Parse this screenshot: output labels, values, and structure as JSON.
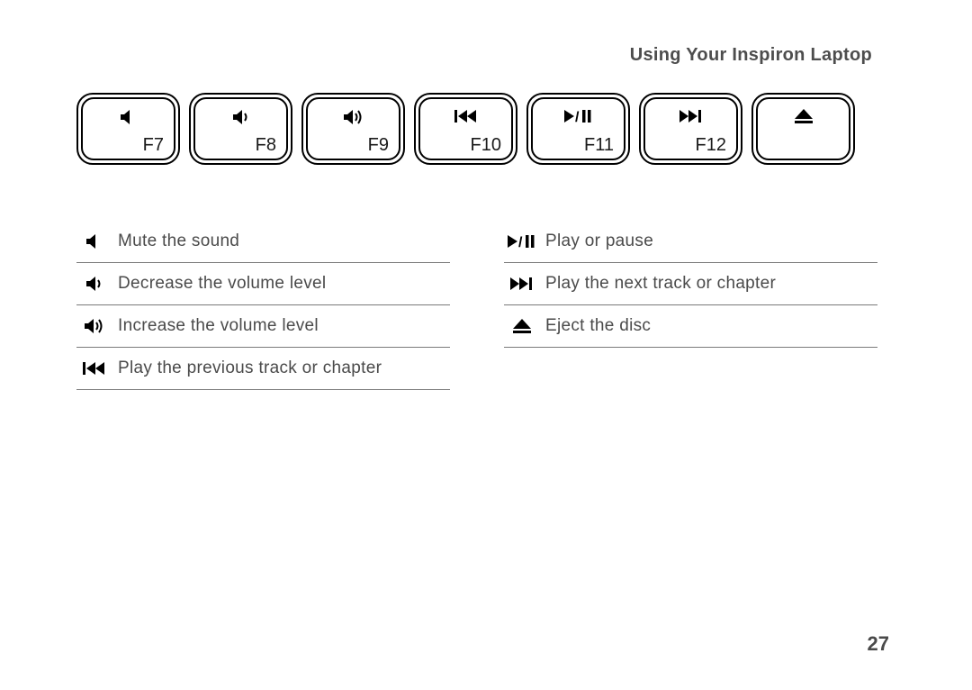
{
  "header": "Using Your Inspiron Laptop",
  "page_number": "27",
  "keys": [
    {
      "icon": "mute",
      "label": "F7"
    },
    {
      "icon": "vol-down",
      "label": "F8"
    },
    {
      "icon": "vol-up",
      "label": "F9"
    },
    {
      "icon": "prev",
      "label": "F10"
    },
    {
      "icon": "play-pause",
      "label": "F11"
    },
    {
      "icon": "next",
      "label": "F12"
    },
    {
      "icon": "eject",
      "label": ""
    }
  ],
  "legend_left": [
    {
      "icon": "mute",
      "text": "Mute the sound"
    },
    {
      "icon": "vol-down",
      "text": "Decrease the volume level"
    },
    {
      "icon": "vol-up",
      "text": "Increase the volume level"
    },
    {
      "icon": "prev",
      "text": "Play the previous track or chapter"
    }
  ],
  "legend_right": [
    {
      "icon": "play-pause",
      "text": "Play or pause"
    },
    {
      "icon": "next",
      "text": "Play the next track or chapter"
    },
    {
      "icon": "eject",
      "text": "Eject the disc"
    }
  ]
}
